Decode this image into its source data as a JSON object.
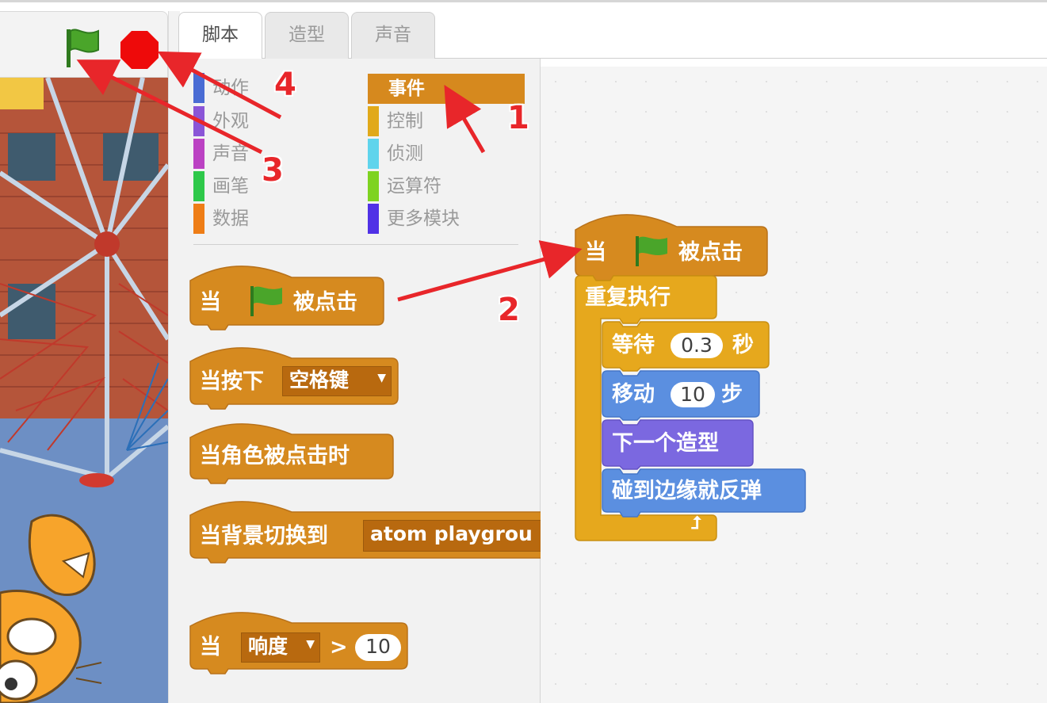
{
  "tabs": [
    {
      "label": "脚本",
      "active": true
    },
    {
      "label": "造型",
      "active": false
    },
    {
      "label": "声音",
      "active": false
    }
  ],
  "stage_controls": {
    "green_flag_icon": "green-flag-icon",
    "stop_icon": "stop-sign-icon",
    "flag_color": "#4aa52a",
    "stop_color": "#ee0a0a"
  },
  "categories_left": [
    {
      "label": "动作",
      "color": "#4a6cd4"
    },
    {
      "label": "外观",
      "color": "#8a55d7"
    },
    {
      "label": "声音",
      "color": "#bb42c3"
    },
    {
      "label": "画笔",
      "color": "#0e9a6c"
    },
    {
      "label": "数据",
      "color": "#ee7d16"
    }
  ],
  "categories_right": [
    {
      "label": "事件",
      "color": "#c88330",
      "selected": true
    },
    {
      "label": "控制",
      "color": "#e1a91a"
    },
    {
      "label": "侦测",
      "color": "#2ca5e2"
    },
    {
      "label": "运算符",
      "color": "#5cb712"
    },
    {
      "label": "更多模块",
      "color": "#632d99"
    }
  ],
  "palette_blocks": {
    "when_flag": {
      "prefix": "当",
      "suffix": "被点击"
    },
    "when_key": {
      "prefix": "当按下",
      "key": "空格键"
    },
    "when_sprite_clicked": {
      "label": "当角色被点击时"
    },
    "when_backdrop": {
      "prefix": "当背景切换到",
      "backdrop": "atom playgrou"
    },
    "when_loudness": {
      "prefix": "当",
      "sensor": "响度",
      "op": ">",
      "value": "10"
    }
  },
  "script": {
    "hat": {
      "prefix": "当",
      "suffix": "被点击"
    },
    "forever": {
      "label": "重复执行"
    },
    "wait": {
      "label": "等待",
      "value": "0.3",
      "unit": "秒"
    },
    "move": {
      "label": "移动",
      "value": "10",
      "unit": "步"
    },
    "next_costume": {
      "label": "下一个造型"
    },
    "bounce": {
      "label": "碰到边缘就反弹"
    }
  },
  "annotations": [
    "1",
    "2",
    "3",
    "4"
  ],
  "colors": {
    "events": "#d68a1f",
    "control": "#e6a81d",
    "motion": "#5b8fe0",
    "looks": "#7b68e0",
    "annotation_red": "#e8262a"
  }
}
